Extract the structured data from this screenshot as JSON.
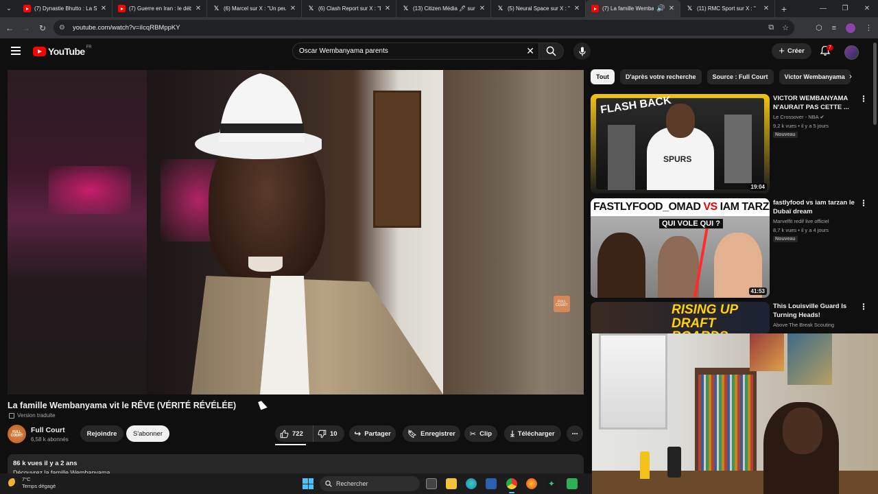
{
  "browser": {
    "tabs": [
      {
        "title": "(7) Dynastie Bhutto : La S",
        "favicon": "youtube"
      },
      {
        "title": "(7) Guerre en Iran : le déb",
        "favicon": "youtube"
      },
      {
        "title": "(6) Marcel sur X : \"Un peu",
        "favicon": "x"
      },
      {
        "title": "(6) Clash Report sur X : \"B",
        "favicon": "x"
      },
      {
        "title": "(13) Citizen Média 🖊 sur",
        "favicon": "x"
      },
      {
        "title": "(5) Neural Space sur X : \"",
        "favicon": "x"
      },
      {
        "title": "(7) La famille Wemba",
        "favicon": "youtube"
      },
      {
        "title": "(11) RMC Sport sur X : \"",
        "favicon": "x"
      }
    ],
    "active_tab": 6,
    "url": "youtube.com/watch?v=iIcqRBMppKY"
  },
  "yt_header": {
    "logo_text": "YouTube",
    "region": "FR",
    "search_value": "Oscar Wembanyama parents",
    "create_label": "Créer",
    "notif_count": "7"
  },
  "video": {
    "title": "La famille Wembanyama vit le RÊVE (VÉRITÉ RÉVÉLÉE)",
    "version_label": "Version traduite",
    "watermark": "FULL COURT",
    "channel_name": "Full Court",
    "channel_subs": "6,58 k abonnés",
    "join_label": "Rejoindre",
    "subscribe_label": "S'abonner",
    "likes": "722",
    "dislikes": "10",
    "share_label": "Partager",
    "save_label": "Enregistrer",
    "clip_label": "Clip",
    "download_label": "Télécharger",
    "stats": "86 k vues  il y a 2 ans",
    "description": "Découvrez la famille Wembanyama"
  },
  "chips": [
    "Tout",
    "D'après votre recherche",
    "Source : Full Court",
    "Victor Wembanyama"
  ],
  "recommendations": [
    {
      "title": "VICTOR WEMBANYAMA N'AURAIT PAS CETTE ...",
      "channel": "Le Crossover - NBA",
      "verified": true,
      "views": "9,2 k vues • il y a 5 jours",
      "badge": "Nouveau",
      "duration": "19:04",
      "thumb_text": "FLASH BACK",
      "jersey_text": "SPURS"
    },
    {
      "title": "fastlyfood  vs iam tarzan le Dubaï dream",
      "channel": "Marvelfit redif live officiel",
      "views": "8,7 k vues • il y a 4 jours",
      "badge": "Nouveau",
      "duration": "41:53",
      "thumb_left": "FASTLYFOOD_OMAD",
      "thumb_vs": "VS",
      "thumb_right": "IAM TARZAN",
      "thumb_question": "QUI VOLE QUI ?"
    },
    {
      "title": "This Louisville Guard Is Turning Heads!",
      "channel": "Above The Break Scouting",
      "thumb_line1": "RISING UP",
      "thumb_line2": "DRAFT BOARDS"
    }
  ],
  "taskbar": {
    "temperature": "7°C",
    "weather": "Temps dégagé",
    "search_label": "Rechercher"
  },
  "colors": {
    "background": "#0f0f0f",
    "accent_red": "#ff0000",
    "chip_bg": "#272727",
    "text": "#f1f1f1",
    "muted": "#aaaaaa"
  }
}
